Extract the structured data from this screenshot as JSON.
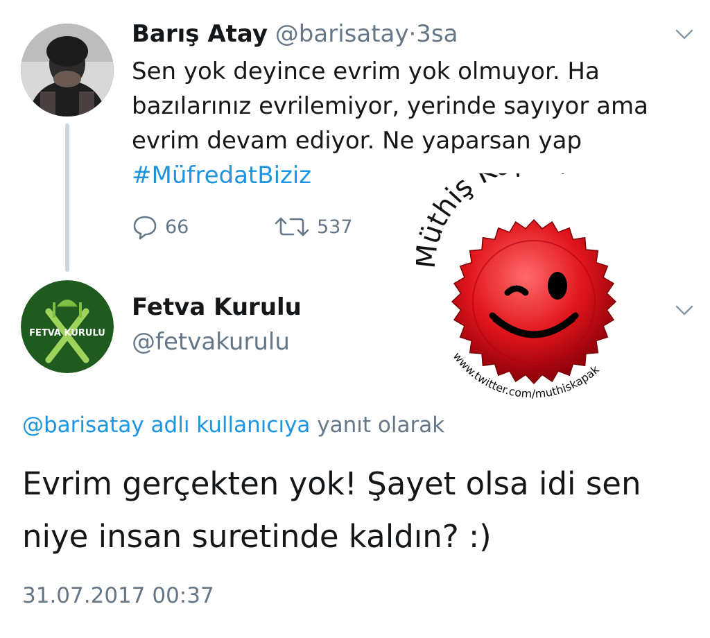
{
  "tweet1": {
    "display_name": "Barış Atay",
    "handle": "@barisatay",
    "separator": "·",
    "time": "3sa",
    "text_lines": [
      "Sen yok deyince evrim yok olmuyor. Ha",
      "bazılarınız evrilemiyor, yerinde sayıyor ama",
      "evrim devam ediyor. Ne yaparsan yap"
    ],
    "hashtag": "#MüfredatBiziz",
    "reply_count": "66",
    "retweet_count": "537",
    "menu_icon": "chevron-down-icon",
    "reply_icon": "reply-bubble-icon",
    "retweet_icon": "retweet-icon"
  },
  "sticker": {
    "arc_text": "Müthiş Kapak",
    "url_text": "www.twitter.com/muthiskapak",
    "cap_color": "#e0141c",
    "icon": "winking-bottlecap-icon"
  },
  "tweet2": {
    "display_name": "Fetva Kurulu",
    "handle": "@fetvakurulu",
    "avatar_text": "FETVA KURULU",
    "avatar_color": "#1f5a1f",
    "reply_to_mention": "@barisatay adlı kullanıcıya",
    "reply_to_suffix": "yanıt olarak",
    "text_lines": [
      "Evrim gerçekten yok! Şayet olsa idi sen",
      "niye insan suretinde kaldın? :)"
    ],
    "timestamp": "31.07.2017 00:37",
    "menu_icon": "chevron-down-icon"
  },
  "colors": {
    "link": "#1b95e0",
    "secondary": "#657786",
    "primary_text": "#14171a",
    "thread_line": "#ccd6dd"
  }
}
